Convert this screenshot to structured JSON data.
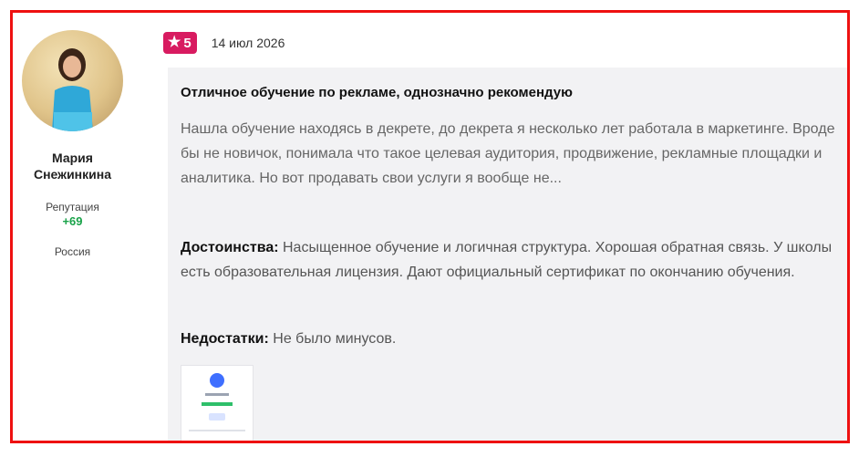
{
  "author": {
    "name": "Мария Снежинкина",
    "reputation_label": "Репутация",
    "reputation_value": "+69",
    "country": "Россия"
  },
  "review": {
    "rating": "5",
    "date": "14 июл 2026",
    "title": "Отличное обучение по рекламе, однозначно рекомендую",
    "text": "Нашла обучение находясь в декрете, до декрета я несколько лет работала в маркетинге. Вроде бы не новичок, понимала что такое целевая аудитория, продвижение, рекламные площадки и аналитика. Но вот продавать свои услуги я вообще не...",
    "pros_label": "Достоинства:",
    "pros_text": "Насыщенное обучение и логичная структура. Хорошая обратная связь. У школы есть образовательная лицензия. Дают официальный сертификат по окончанию обучения.",
    "cons_label": "Недостатки:",
    "cons_text": "Не было минусов.",
    "attachment_icon": "image-thumbnail"
  },
  "colors": {
    "frame_border": "#ee1111",
    "rating_badge": "#d81b60",
    "reputation": "#1aa34a",
    "review_background": "#f2f2f4"
  }
}
